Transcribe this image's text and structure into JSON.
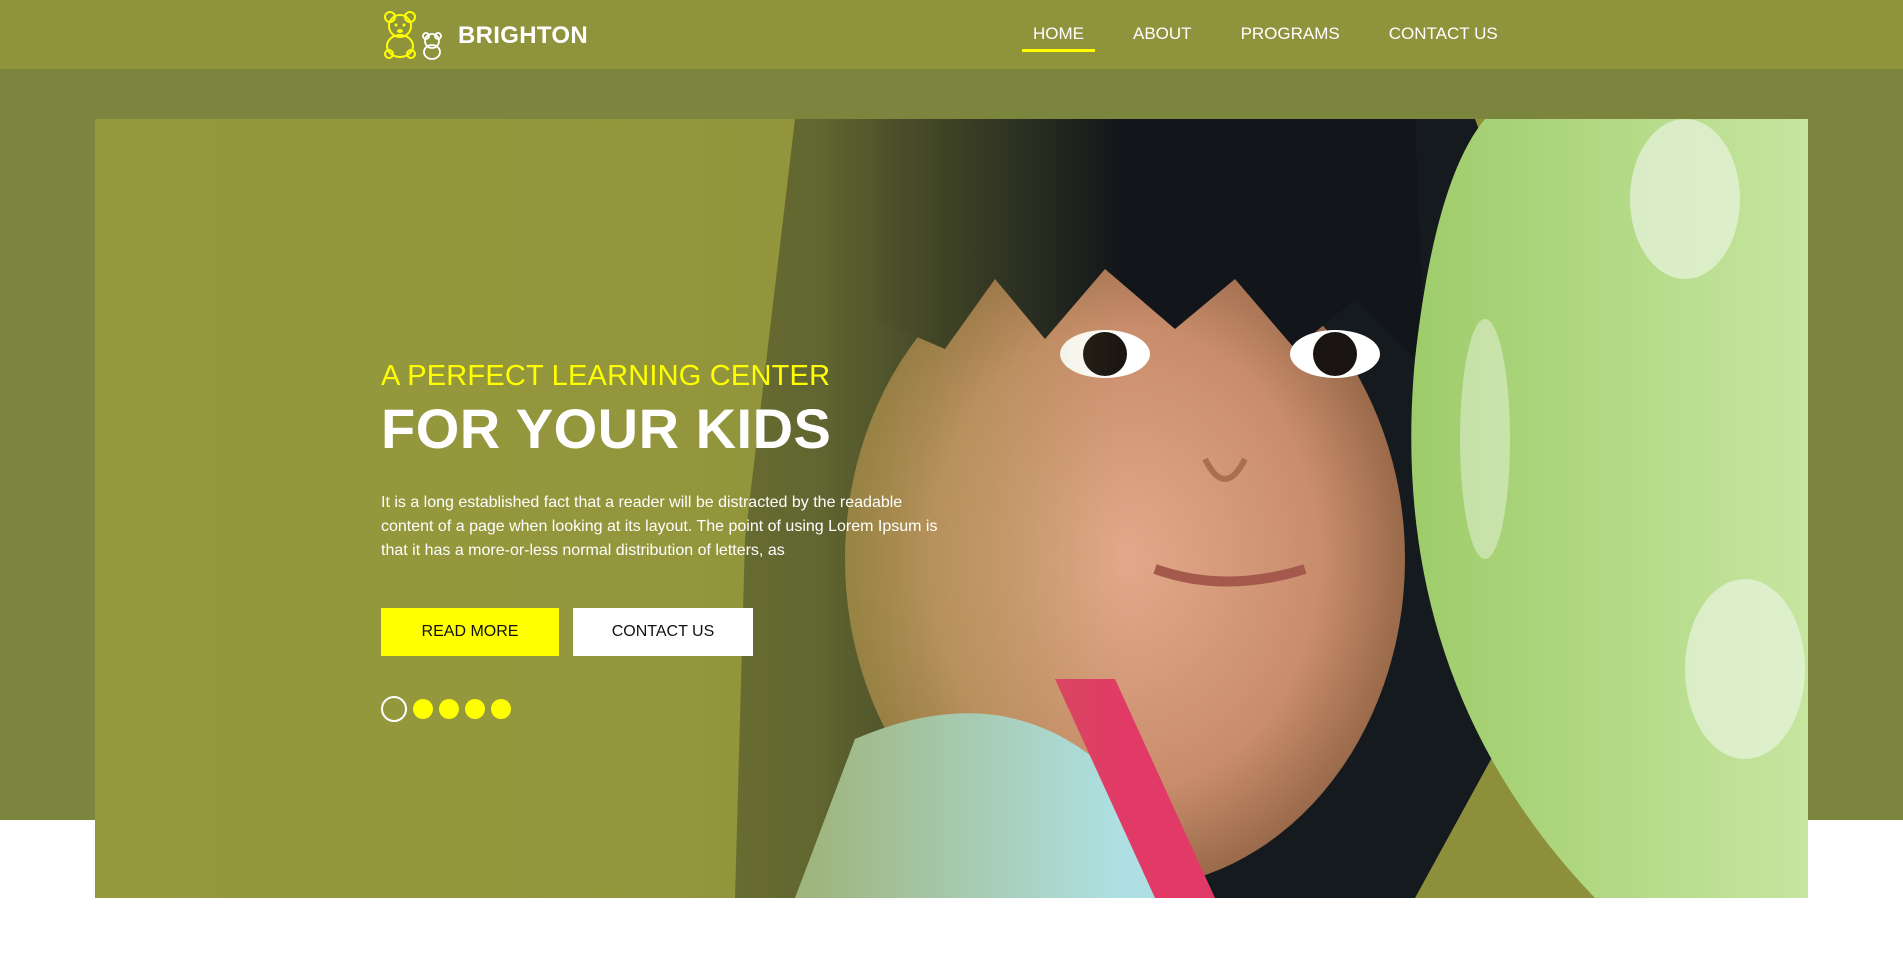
{
  "header": {
    "brand": "BRIGHTON",
    "nav": [
      {
        "label": "HOME",
        "active": true
      },
      {
        "label": "ABOUT",
        "active": false
      },
      {
        "label": "PROGRAMS",
        "active": false
      },
      {
        "label": "CONTACT US",
        "active": false
      }
    ]
  },
  "hero": {
    "subtitle": "A PERFECT LEARNING CENTER",
    "title": "FOR YOUR KIDS",
    "description": "It is a long established fact that a reader will be distracted by the readable content of a page when looking at its layout. The point of using Lorem Ipsum is that it has a more-or-less normal distribution of letters, as",
    "buttons": {
      "read_more": "READ MORE",
      "contact": "CONTACT US"
    },
    "slides": {
      "count": 5,
      "active_index": 0
    }
  },
  "icons": {
    "logo": "teddy-bear-icon"
  },
  "colors": {
    "header_bg": "#8f943c",
    "band_bg": "#7b853e",
    "accent": "#ffff00",
    "text": "#ffffff"
  }
}
